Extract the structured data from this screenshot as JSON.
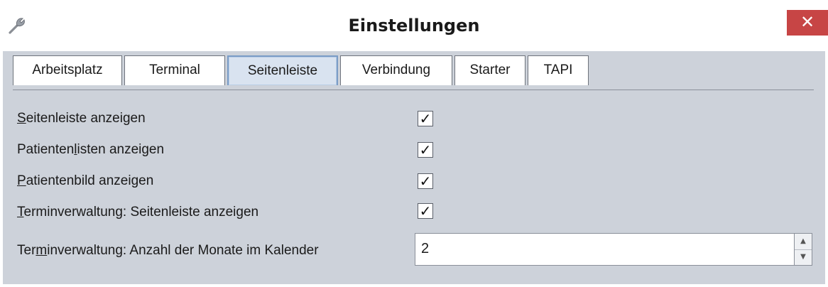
{
  "window": {
    "title": "Einstellungen",
    "close_symbol": "✕",
    "icon": "wrench-icon"
  },
  "tabs": [
    {
      "label": "Arbeitsplatz",
      "active": false
    },
    {
      "label": "Terminal",
      "active": false
    },
    {
      "label": "Seitenleiste",
      "active": true
    },
    {
      "label": "Verbindung",
      "active": false
    },
    {
      "label": "Starter",
      "active": false
    },
    {
      "label": "TAPI",
      "active": false
    }
  ],
  "settings": {
    "row1": {
      "mnemonic": "S",
      "rest": "eitenleiste anzeigen",
      "checked": true
    },
    "row2": {
      "pre": "Patienten",
      "mnemonic": "l",
      "rest": "isten anzeigen",
      "checked": true
    },
    "row3": {
      "mnemonic": "P",
      "rest": "atientenbild anzeigen",
      "checked": true
    },
    "row4": {
      "mnemonic": "T",
      "rest": "erminverwaltung: Seitenleiste anzeigen",
      "checked": true
    },
    "row5": {
      "pre": "Ter",
      "mnemonic": "m",
      "rest": "inverwaltung: Anzahl der Monate im Kalender",
      "value": "2"
    }
  },
  "check_symbol": "✓",
  "spinner": {
    "up_symbol": "▲",
    "down_symbol": "▼"
  },
  "colors": {
    "close": "#c74545",
    "panel": "#cdd2da",
    "active_tab": "#d9e3f0"
  }
}
